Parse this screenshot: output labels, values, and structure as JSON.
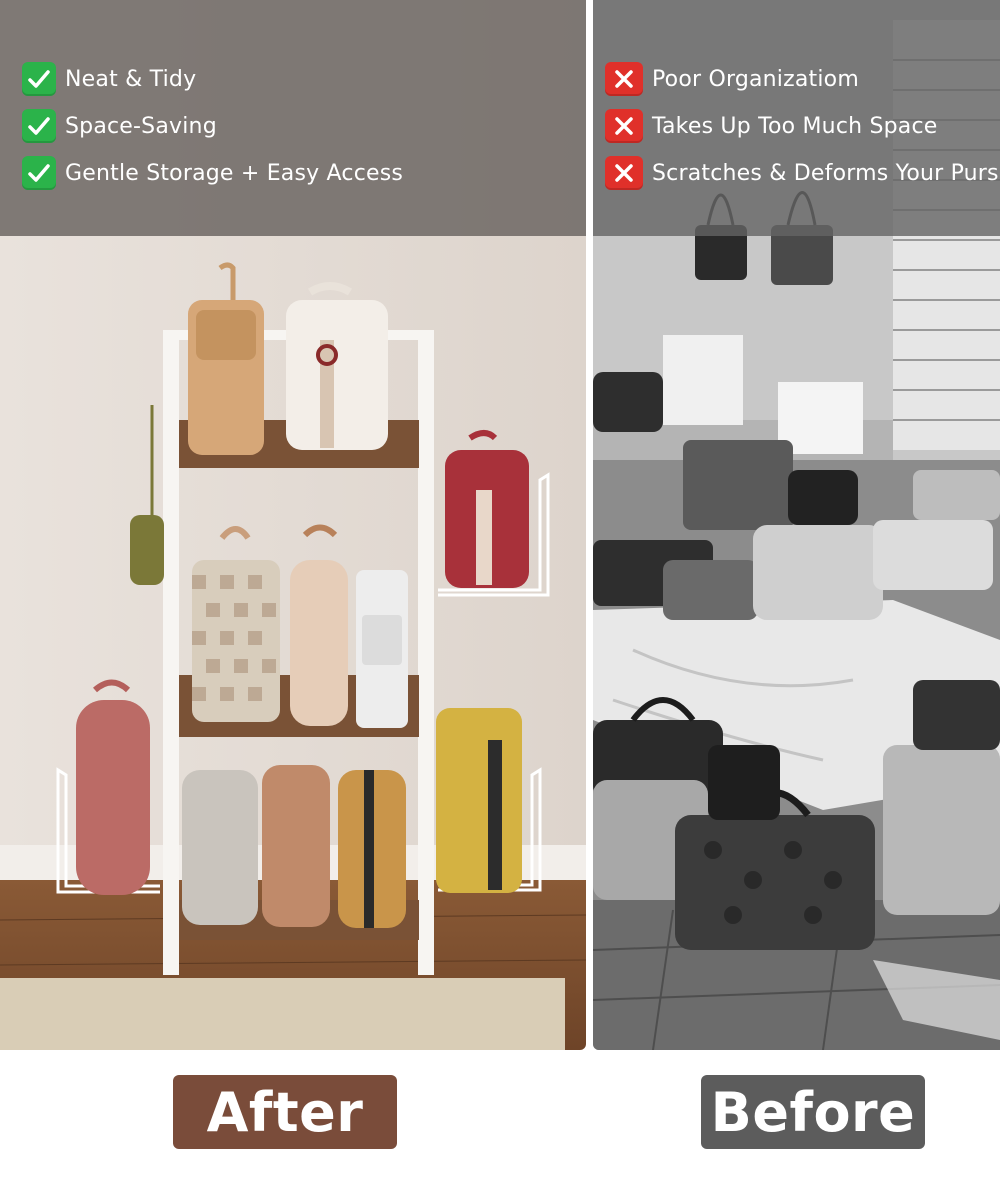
{
  "after": {
    "label": "After",
    "label_color": "#7a4c3a",
    "features": [
      {
        "icon": "check-icon",
        "text": "Neat & Tidy"
      },
      {
        "icon": "check-icon",
        "text": "Space-Saving"
      },
      {
        "icon": "check-icon",
        "text": "Gentle Storage + Easy Access"
      }
    ]
  },
  "before": {
    "label": "Before",
    "label_color": "#5c5c5c",
    "features": [
      {
        "icon": "cross-icon",
        "text": "Poor Organizatiom"
      },
      {
        "icon": "cross-icon",
        "text": "Takes Up Too Much Space"
      },
      {
        "icon": "cross-icon",
        "text": "Scratches & Deforms Your Purses"
      }
    ]
  },
  "colors": {
    "check": "#2bb34a",
    "cross": "#e0302a"
  }
}
